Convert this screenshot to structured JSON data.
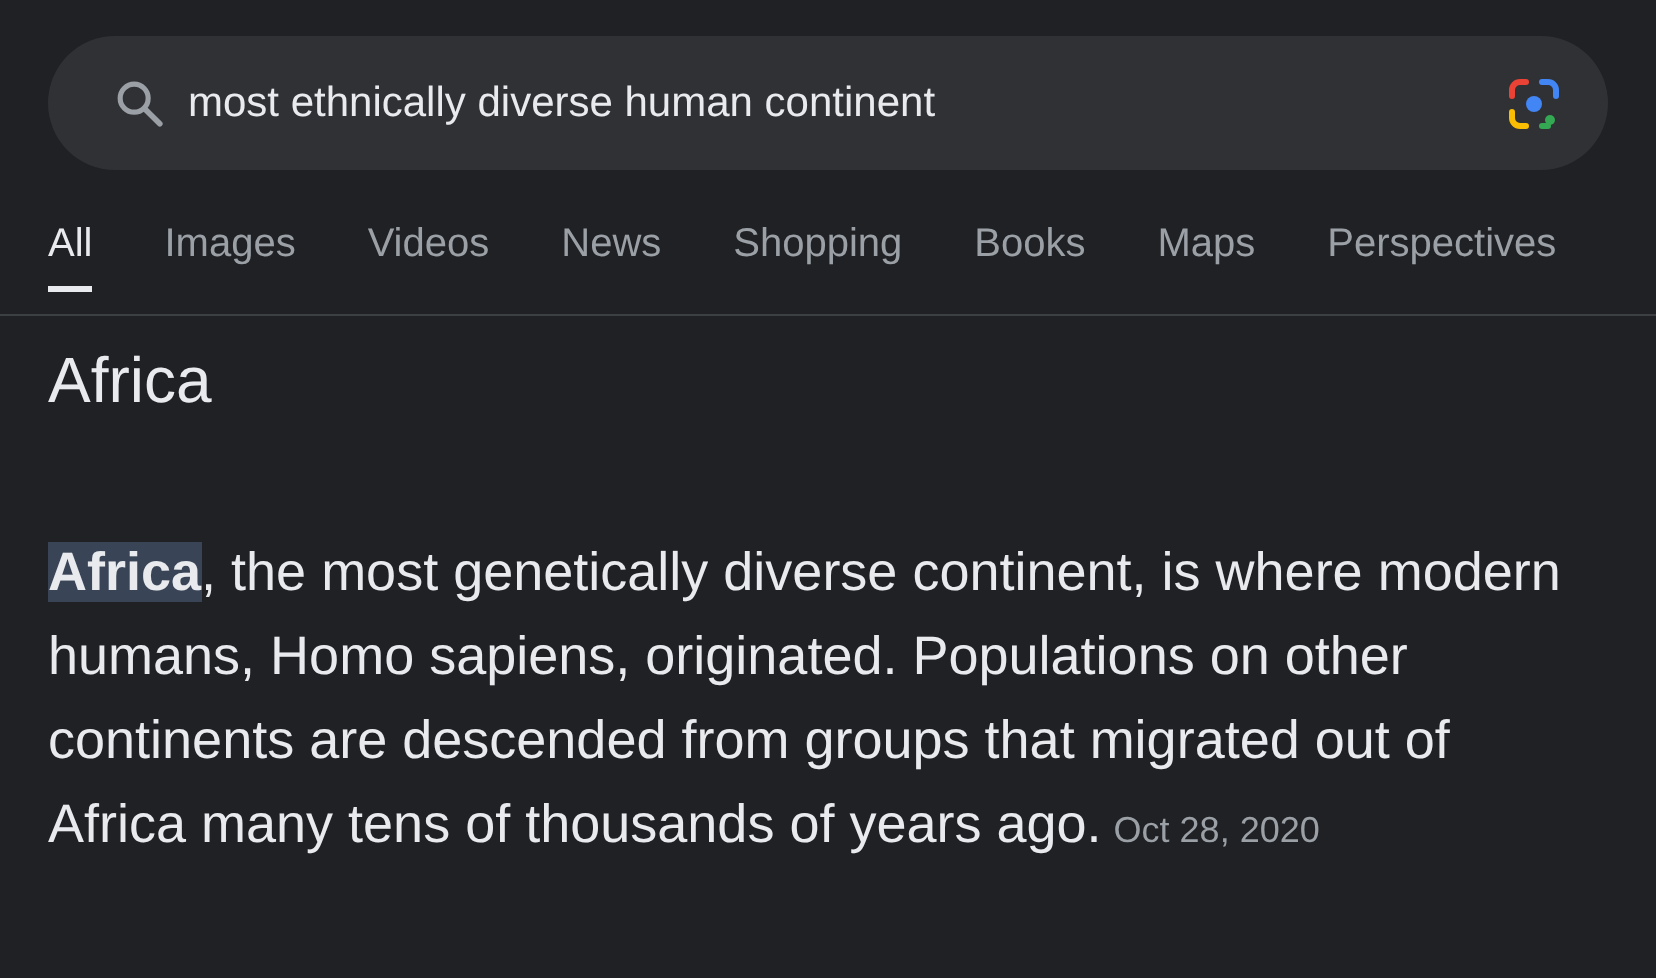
{
  "search": {
    "value": "most ethnically diverse human continent"
  },
  "tabs": [
    {
      "label": "All",
      "selected": true
    },
    {
      "label": "Images",
      "selected": false
    },
    {
      "label": "Videos",
      "selected": false
    },
    {
      "label": "News",
      "selected": false
    },
    {
      "label": "Shopping",
      "selected": false
    },
    {
      "label": "Books",
      "selected": false
    },
    {
      "label": "Maps",
      "selected": false
    },
    {
      "label": "Perspectives",
      "selected": false
    }
  ],
  "answer": {
    "title": "Africa",
    "snippet": "**Africa**, the most genetically diverse continent, is where modern humans, Homo sapiens, originated. Populations on other continents are descended from groups that migrated out of Africa many tens of thousands of years ago.",
    "date": "Oct 28, 2020"
  }
}
